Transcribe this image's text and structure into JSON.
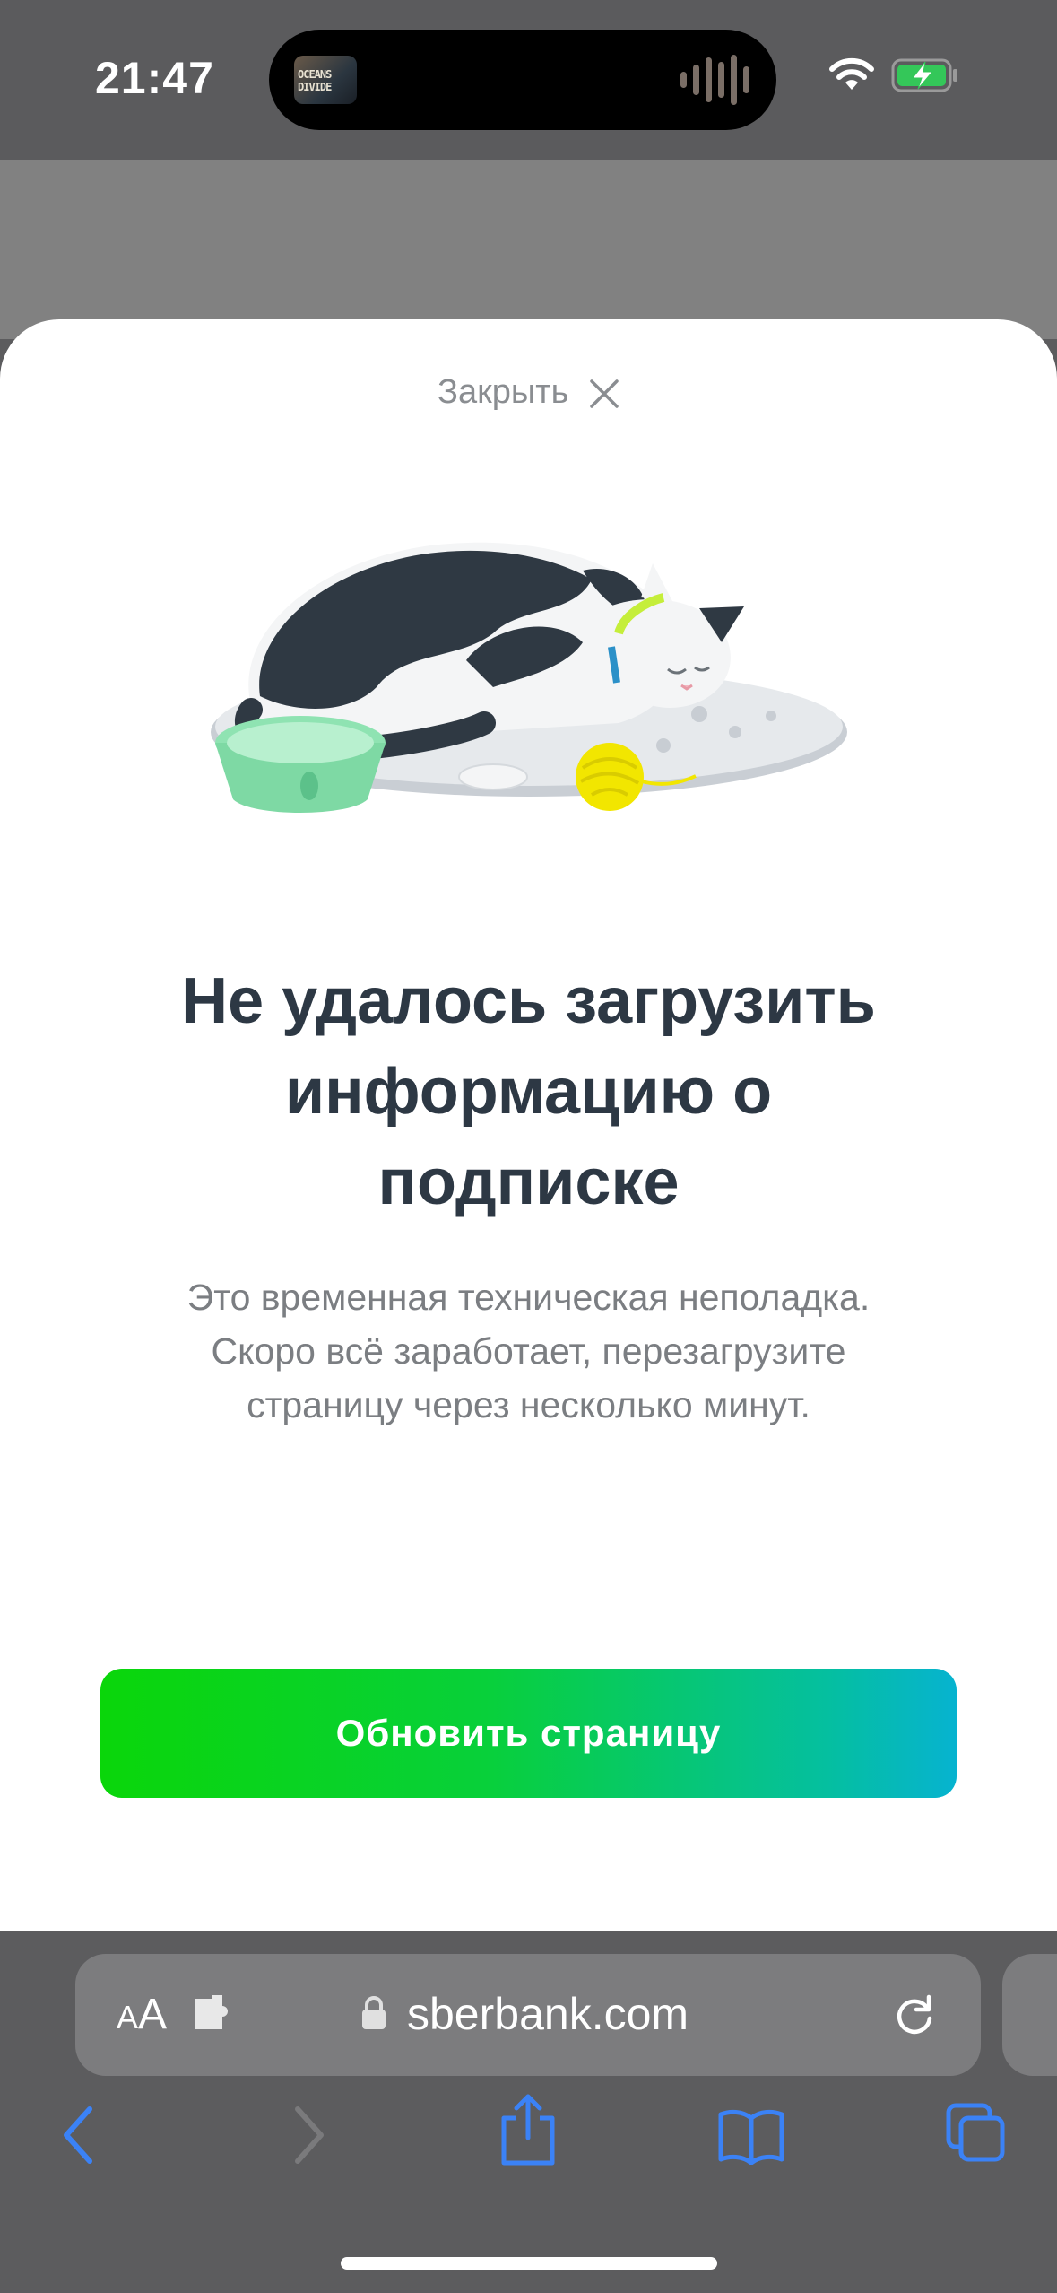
{
  "status": {
    "time": "21:47",
    "album_art_text": "OCEANS DIVIDE"
  },
  "sheet": {
    "close_label": "Закрыть",
    "title_lines": [
      "Не удалось загрузить",
      "информацию о",
      "подписке"
    ],
    "subtitle_lines": [
      "Это временная техническая неполадка.",
      "Скоро всё заработает, перезагрузите",
      "страницу через несколько минут."
    ],
    "button_label": "Обновить страницу",
    "illustration": "sleeping-cat-with-bowl-and-yarn"
  },
  "browser": {
    "text_size_small": "A",
    "text_size_big": "A",
    "domain": "sberbank.com",
    "icons": [
      "text-size-icon",
      "extension-icon",
      "lock-icon",
      "reload-icon",
      "back-icon",
      "forward-icon",
      "share-icon",
      "bookmarks-icon",
      "tabs-icon"
    ]
  },
  "colors": {
    "accent_start": "#0ad60a",
    "accent_end": "#06b3d0",
    "title": "#2d3844",
    "nav_blue": "#3b82f6"
  }
}
